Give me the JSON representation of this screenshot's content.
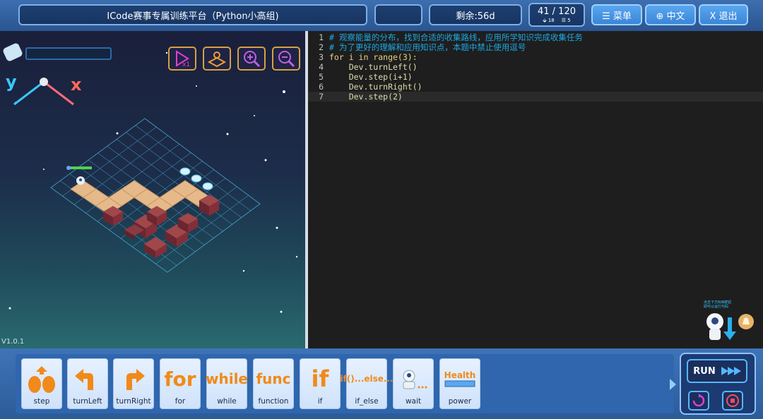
{
  "header": {
    "title": "ICode赛事专属训练平台（Python小高组)",
    "empty_pill": "",
    "remaining": "剩余:56d",
    "score": {
      "current": "41 / 120",
      "stat1": "18",
      "stat2": "5"
    },
    "menu_label": "☰ 菜单",
    "lang_label": "⊕ 中文",
    "exit_label": "X 退出"
  },
  "scene": {
    "version": "V1.0.1",
    "axis_y": "y",
    "axis_x": "x",
    "tools": [
      "play-x1-icon",
      "map-icon",
      "zoom-in-icon",
      "zoom-out-icon"
    ],
    "hint_text_1": "点击下方RUN按钮",
    "hint_text_2": "即可以运行代码"
  },
  "editor": {
    "lines": [
      {
        "n": "1",
        "text": "# 观察能量的分布，找到合适的收集路线，应用所学知识完成收集任务"
      },
      {
        "n": "2",
        "text": "# 为了更好的理解和应用知识点，本题中禁止使用逗号"
      },
      {
        "n": "3",
        "text": "for i in range(3):"
      },
      {
        "n": "4",
        "text": "    Dev.turnLeft()"
      },
      {
        "n": "5",
        "text": "    Dev.step(i+1)"
      },
      {
        "n": "6",
        "text": "    Dev.turnRight()"
      },
      {
        "n": "7",
        "text": "    Dev.step(2)"
      }
    ]
  },
  "blocks": [
    {
      "label": "step",
      "icon": "step-icon"
    },
    {
      "label": "turnLeft",
      "icon": "turn-left-icon"
    },
    {
      "label": "turnRight",
      "icon": "turn-right-icon"
    },
    {
      "label": "for",
      "icon_text": "for"
    },
    {
      "label": "while",
      "icon_text": "while"
    },
    {
      "label": "function",
      "icon_text": "func"
    },
    {
      "label": "if",
      "icon_text": "if"
    },
    {
      "label": "if_else",
      "icon_text": "if()...else..."
    },
    {
      "label": "wait",
      "icon": "wait-icon"
    },
    {
      "label": "power",
      "icon_text": "Health"
    }
  ],
  "run": {
    "label": "RUN"
  },
  "colors": {
    "accent": "#3b86d8",
    "orange": "#f08a1a",
    "comment": "#1ba8e6"
  }
}
